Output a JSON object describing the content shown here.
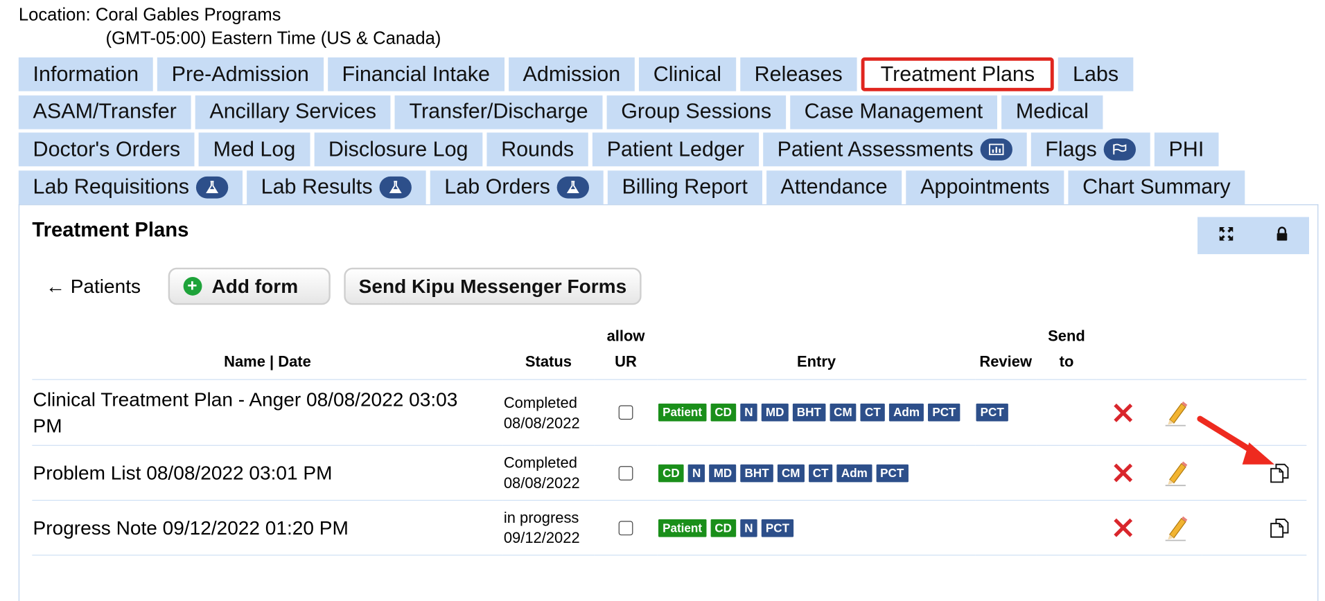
{
  "location": {
    "label": "Location: Coral Gables Programs",
    "timezone": "(GMT-05:00) Eastern Time (US & Canada)"
  },
  "tabs": {
    "rows": [
      [
        "Information",
        "Pre-Admission",
        "Financial Intake",
        "Admission",
        "Clinical",
        "Releases",
        "Treatment Plans",
        "Labs"
      ],
      [
        "ASAM/Transfer",
        "Ancillary Services",
        "Transfer/Discharge",
        "Group Sessions",
        "Case Management",
        "Medical"
      ],
      [
        "Doctor's Orders",
        "Med Log",
        "Disclosure Log",
        "Rounds",
        "Patient Ledger",
        "Patient Assessments",
        "Flags",
        "PHI"
      ],
      [
        "Lab Requisitions",
        "Lab Results",
        "Lab Orders",
        "Billing Report",
        "Attendance",
        "Appointments",
        "Chart Summary"
      ]
    ],
    "active": "Treatment Plans"
  },
  "panel": {
    "title": "Treatment Plans",
    "back_label": "← Patients",
    "add_form_label": "Add form",
    "send_messenger_label": "Send Kipu Messenger Forms"
  },
  "table": {
    "headers": {
      "name_date": "Name | Date",
      "status": "Status",
      "allow_ur_1": "allow",
      "allow_ur_2": "UR",
      "entry": "Entry",
      "review": "Review",
      "send_to_1": "Send",
      "send_to_2": "to"
    },
    "rows": [
      {
        "name": "Clinical Treatment Plan - Anger 08/08/2022 03:03 PM",
        "status": "Completed",
        "status_date": "08/08/2022",
        "allow_ur": false,
        "entry": [
          "Patient",
          "CD",
          "N",
          "MD",
          "BHT",
          "CM",
          "CT",
          "Adm",
          "PCT"
        ],
        "review": [
          "PCT"
        ],
        "has_copy": false
      },
      {
        "name": "Problem List 08/08/2022 03:01 PM",
        "status": "Completed",
        "status_date": "08/08/2022",
        "allow_ur": false,
        "entry": [
          "CD",
          "N",
          "MD",
          "BHT",
          "CM",
          "CT",
          "Adm",
          "PCT"
        ],
        "review": [],
        "has_copy": true
      },
      {
        "name": "Progress Note 09/12/2022 01:20 PM",
        "status": "in progress",
        "status_date": "09/12/2022",
        "allow_ur": false,
        "entry": [
          "Patient",
          "CD",
          "N",
          "PCT"
        ],
        "review": [],
        "has_copy": true
      }
    ]
  },
  "colors": {
    "tab_bg": "#c7dcf5",
    "active_tab_border": "#e0261f",
    "badge_blue": "#2d4f8a",
    "badge_green": "#1a8f1a",
    "delete_red": "#d9262c",
    "annotation_arrow": "#ee2a1f"
  },
  "icons": {
    "tab_badges": {
      "Patient Assessments": "bar-chart-icon",
      "Flags": "flag-icon",
      "Lab Requisitions": "flask-icon",
      "Lab Results": "flask-icon",
      "Lab Orders": "flask-icon"
    },
    "panel_tools": [
      "expand-icon",
      "lock-icon"
    ],
    "row_actions": [
      "delete-icon",
      "edit-pencil-icon",
      "copy-icon"
    ]
  }
}
